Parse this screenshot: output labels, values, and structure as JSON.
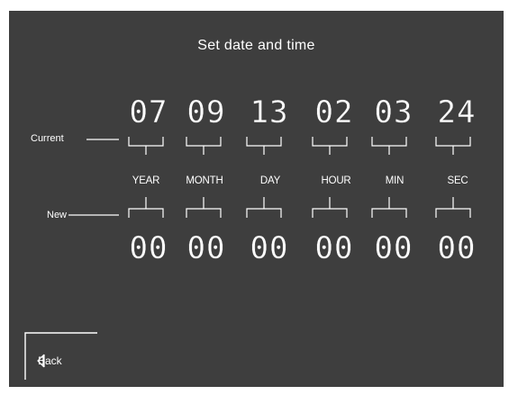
{
  "title": "Set date and time",
  "side_labels": {
    "current": "Current",
    "new": "New"
  },
  "fields": [
    {
      "label": "YEAR",
      "current": "07",
      "new": "00"
    },
    {
      "label": "MONTH",
      "current": "09",
      "new": "00"
    },
    {
      "label": "DAY",
      "current": "13",
      "new": "00"
    },
    {
      "label": "HOUR",
      "current": "02",
      "new": "00"
    },
    {
      "label": "MIN",
      "current": "03",
      "new": "00"
    },
    {
      "label": "SEC",
      "current": "24",
      "new": "00"
    }
  ],
  "back_button": {
    "label": "Back",
    "icon": "back-arrow-icon"
  },
  "colors": {
    "background": "#3e3e3e",
    "foreground": "#ffffff",
    "frame": "#ffffff"
  }
}
